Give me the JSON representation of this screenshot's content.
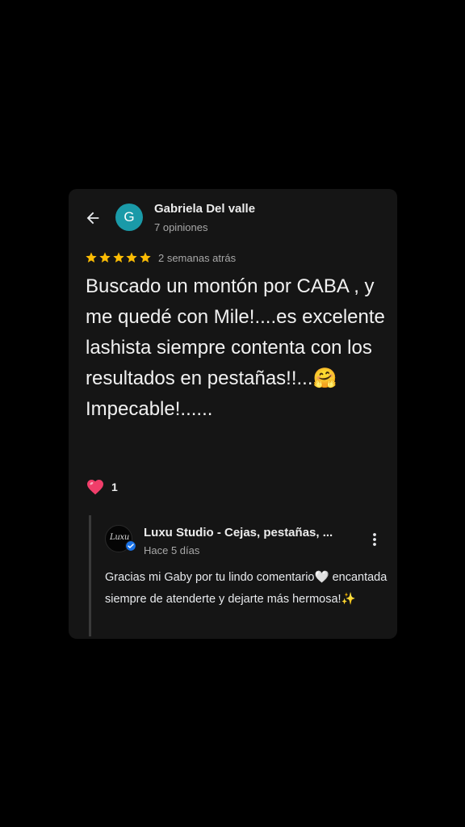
{
  "colors": {
    "background": "#000000",
    "card_background": "#151515",
    "avatar_background": "#1a9aa8",
    "star_color": "#fbbc04",
    "heart_color": "#f03e6a",
    "verified_color": "#1a73e8"
  },
  "review": {
    "avatar_letter": "G",
    "reviewer_name": "Gabriela Del valle",
    "reviewer_review_count": "7 opiniones",
    "rating": 5,
    "time_ago": "2 semanas atrás",
    "text": "Buscado un montón por CABA , y me quedé con Mile!....es excelente lashista siempre contenta con los resultados en pestañas!!...🤗 Impecable!......",
    "reaction_count": "1"
  },
  "owner_reply": {
    "logo_text": "Luxu",
    "owner_name": "Luxu Studio - Cejas, pestañas, ...",
    "time_ago": "Hace 5 días",
    "text": "Gracias mi Gaby por tu lindo comentario🤍 encantada siempre de atenderte y dejarte más hermosa!✨"
  },
  "icons": {
    "back": "arrow-left-icon",
    "star": "star-icon",
    "heart": "heart-icon",
    "verified": "verified-check-icon",
    "more": "more-vertical-icon"
  }
}
